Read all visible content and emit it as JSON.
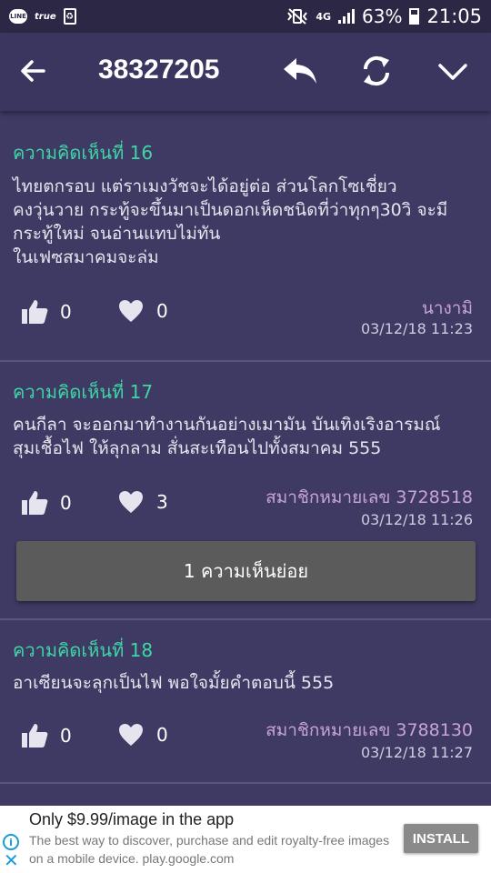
{
  "status_bar": {
    "line_label": "LINE",
    "true_label": "true",
    "recycle_label": "♻",
    "network": "4G",
    "battery": "63%",
    "battery_level": 0.63,
    "time": "21:05"
  },
  "header": {
    "topic_id": "38327205"
  },
  "comments": [
    {
      "title": "ความคิดเห็นที่ 16",
      "body": "ไทยตกรอบ  แต่ราเมงวัชจะได้อยู่ต่อ ส่วนโลกโซเชี่ยว\nคงวุ่นวาย กระทู้จะขึ้นมาเป็นดอกเห็ดชนิดที่ว่าทุกๆ30วิ จะมี\nกระทู้ใหม่ จนอ่านแทบไม่ทัน\nในเฟซสมาคมจะล่ม",
      "likes": "0",
      "hearts": "0",
      "author": "นางามิ",
      "date": "03/12/18 11:23"
    },
    {
      "title": "ความคิดเห็นที่ 17",
      "body": "คนกีลา จะออกมาทำงานกันอย่างเมามัน บันเทิงเริงอารมณ์\nสุมเชื้อไฟ ให้ลุกลาม สั่นสะเทือนไปทั้งสมาคม 555",
      "likes": "0",
      "hearts": "3",
      "author": "สมาชิกหมายเลข 3728518",
      "date": "03/12/18 11:26",
      "sub_replies_label": "1 ความเห็นย่อย"
    },
    {
      "title": "ความคิดเห็นที่ 18",
      "body": "อาเซียนจะลุกเป็นไฟ  พอใจมั้ยคำตอบนี้ 555",
      "likes": "0",
      "hearts": "0",
      "author": "สมาชิกหมายเลข 3788130",
      "date": "03/12/18 11:27"
    }
  ],
  "ad": {
    "title": "Only $9.99/image in the app",
    "description": "The best way to discover, purchase and edit royalty-free images on a mobile device. play.google.com",
    "install_label": "INSTALL",
    "close_label": "✕",
    "info_label": "i"
  },
  "colors": {
    "background": "#3f3a63",
    "header": "#3b3660",
    "comment_title": "#3fd6a6",
    "author": "#c8a3d9"
  }
}
